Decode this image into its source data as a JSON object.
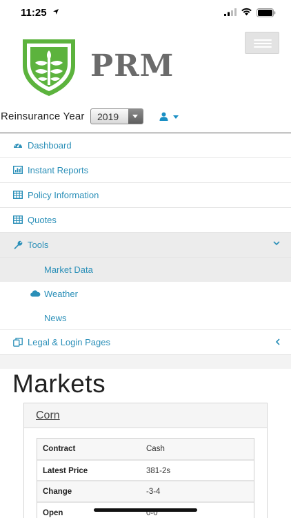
{
  "status_bar": {
    "time": "11:25"
  },
  "header": {
    "logo_text": "PRM",
    "brand_color": "#5cb33d"
  },
  "year_row": {
    "label": "Reinsurance Year",
    "selected_year": "2019"
  },
  "nav": {
    "items": [
      {
        "label": "Dashboard",
        "icon": "dashboard-icon"
      },
      {
        "label": "Instant Reports",
        "icon": "bar-chart-icon"
      },
      {
        "label": "Policy Information",
        "icon": "table-icon"
      },
      {
        "label": "Quotes",
        "icon": "table-icon"
      },
      {
        "label": "Tools",
        "icon": "wrench-icon"
      },
      {
        "label": "Legal & Login Pages",
        "icon": "copy-icon"
      }
    ],
    "tools_sub": [
      {
        "label": "Market Data"
      },
      {
        "label": "Weather",
        "icon": "cloud-icon"
      },
      {
        "label": "News"
      }
    ],
    "link_color": "#2a8fb8"
  },
  "main": {
    "title": "Markets",
    "panel_title": "Corn",
    "table": [
      {
        "key": "Contract",
        "value": "Cash"
      },
      {
        "key": "Latest Price",
        "value": "381-2s"
      },
      {
        "key": "Change",
        "value": "-3-4"
      },
      {
        "key": "Open",
        "value": "0-0"
      }
    ]
  }
}
